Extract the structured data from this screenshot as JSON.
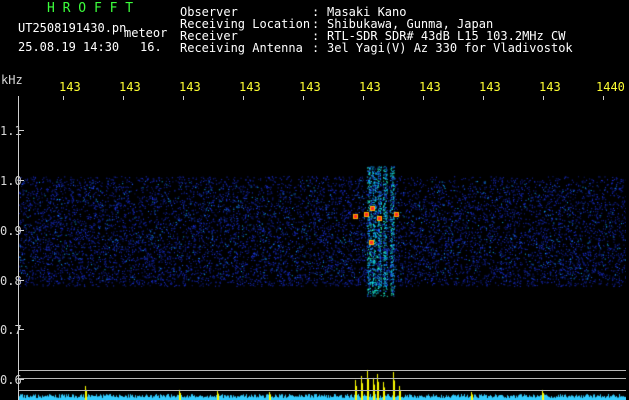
{
  "header": {
    "title": "H R O F F T",
    "filename": "UT2508191430.pn",
    "label_meteor": "meteor",
    "datetime": "25.08.19 14:30",
    "count": "16.",
    "info": [
      {
        "key": "Observer",
        "sep": ":",
        "value": "Masaki Kano"
      },
      {
        "key": "Receiving Location",
        "sep": ":",
        "value": "Shibukawa, Gunma, Japan"
      },
      {
        "key": "Receiver",
        "sep": ":",
        "value": "RTL-SDR SDR# 43dB L15 103.2MHz CW"
      },
      {
        "key": "Receiving Antenna",
        "sep": ":",
        "value": "3el Yagi(V) Az 330 for Vladivostok"
      }
    ]
  },
  "axis": {
    "y_unit": "kHz",
    "y_ticks": [
      "1.1",
      "1.0",
      "0.9",
      "0.8",
      "0.7",
      "0.6"
    ],
    "x_ticks": [
      "143",
      "143",
      "143",
      "143",
      "143",
      "143",
      "143",
      "143",
      "143",
      "1440"
    ]
  },
  "colors": {
    "background": "#000000",
    "title": "#3cff3c",
    "time_ticks": "#ffff33",
    "noise": "#1a2ad8",
    "echo_hot": "#ff2a2a",
    "spectrum": "#33ccff",
    "spectrum_peak": "#ffff00"
  }
}
